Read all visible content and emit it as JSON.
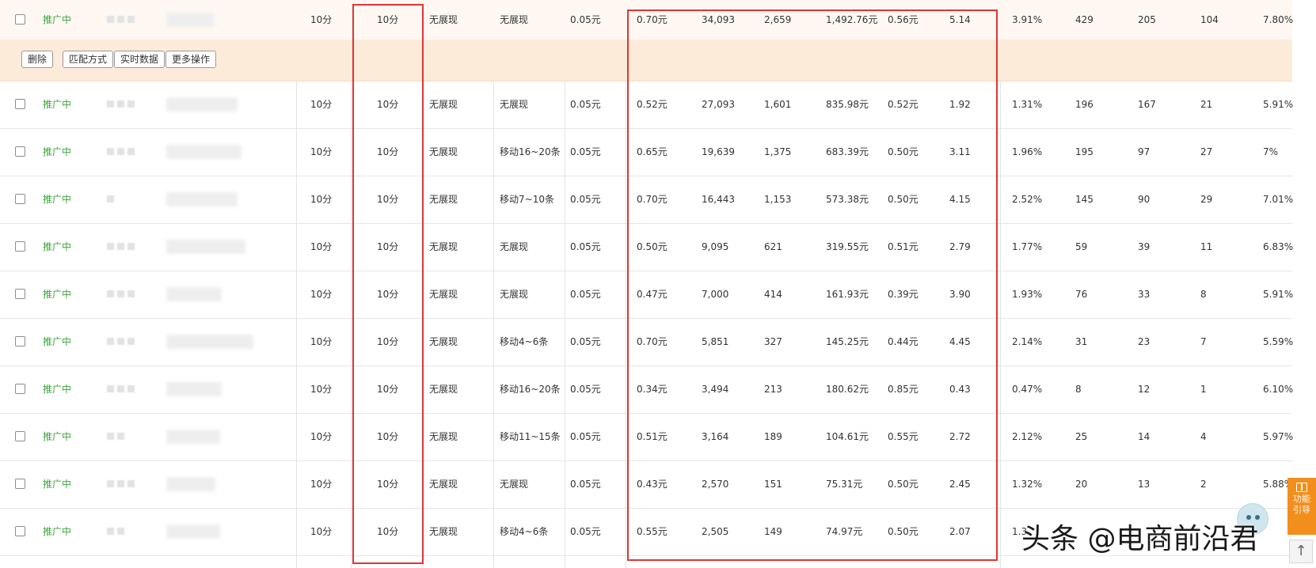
{
  "status_label": "推广中",
  "actions": [
    "删除",
    "匹配方式",
    "实时数据",
    "更多操作"
  ],
  "rows": [
    {
      "a": "10分",
      "b": "10分",
      "c": "无展现",
      "d": "无展现",
      "e": "0.05元",
      "f": "0.70元",
      "g": "34,093",
      "h": "2,659",
      "i": "1,492.76元",
      "j": "0.56元",
      "k": "5.14",
      "l": "3.91%",
      "m": "429",
      "n": "205",
      "o": "104",
      "p": "7.80%"
    },
    {
      "a": "10分",
      "b": "10分",
      "c": "无展现",
      "d": "无展现",
      "e": "0.05元",
      "f": "0.52元",
      "g": "27,093",
      "h": "1,601",
      "i": "835.98元",
      "j": "0.52元",
      "k": "1.92",
      "l": "1.31%",
      "m": "196",
      "n": "167",
      "o": "21",
      "p": "5.91%"
    },
    {
      "a": "10分",
      "b": "10分",
      "c": "无展现",
      "d": "移动16~20条",
      "e": "0.05元",
      "f": "0.65元",
      "g": "19,639",
      "h": "1,375",
      "i": "683.39元",
      "j": "0.50元",
      "k": "3.11",
      "l": "1.96%",
      "m": "195",
      "n": "97",
      "o": "27",
      "p": "7%"
    },
    {
      "a": "10分",
      "b": "10分",
      "c": "无展现",
      "d": "移动7~10条",
      "e": "0.05元",
      "f": "0.70元",
      "g": "16,443",
      "h": "1,153",
      "i": "573.38元",
      "j": "0.50元",
      "k": "4.15",
      "l": "2.52%",
      "m": "145",
      "n": "90",
      "o": "29",
      "p": "7.01%"
    },
    {
      "a": "10分",
      "b": "10分",
      "c": "无展现",
      "d": "无展现",
      "e": "0.05元",
      "f": "0.50元",
      "g": "9,095",
      "h": "621",
      "i": "319.55元",
      "j": "0.51元",
      "k": "2.79",
      "l": "1.77%",
      "m": "59",
      "n": "39",
      "o": "11",
      "p": "6.83%"
    },
    {
      "a": "10分",
      "b": "10分",
      "c": "无展现",
      "d": "无展现",
      "e": "0.05元",
      "f": "0.47元",
      "g": "7,000",
      "h": "414",
      "i": "161.93元",
      "j": "0.39元",
      "k": "3.90",
      "l": "1.93%",
      "m": "76",
      "n": "33",
      "o": "8",
      "p": "5.91%"
    },
    {
      "a": "10分",
      "b": "10分",
      "c": "无展现",
      "d": "移动4~6条",
      "e": "0.05元",
      "f": "0.70元",
      "g": "5,851",
      "h": "327",
      "i": "145.25元",
      "j": "0.44元",
      "k": "4.45",
      "l": "2.14%",
      "m": "31",
      "n": "23",
      "o": "7",
      "p": "5.59%"
    },
    {
      "a": "10分",
      "b": "10分",
      "c": "无展现",
      "d": "移动16~20条",
      "e": "0.05元",
      "f": "0.34元",
      "g": "3,494",
      "h": "213",
      "i": "180.62元",
      "j": "0.85元",
      "k": "0.43",
      "l": "0.47%",
      "m": "8",
      "n": "12",
      "o": "1",
      "p": "6.10%"
    },
    {
      "a": "10分",
      "b": "10分",
      "c": "无展现",
      "d": "移动11~15条",
      "e": "0.05元",
      "f": "0.51元",
      "g": "3,164",
      "h": "189",
      "i": "104.61元",
      "j": "0.55元",
      "k": "2.72",
      "l": "2.12%",
      "m": "25",
      "n": "14",
      "o": "4",
      "p": "5.97%"
    },
    {
      "a": "10分",
      "b": "10分",
      "c": "无展现",
      "d": "无展现",
      "e": "0.05元",
      "f": "0.43元",
      "g": "2,570",
      "h": "151",
      "i": "75.31元",
      "j": "0.50元",
      "k": "2.45",
      "l": "1.32%",
      "m": "20",
      "n": "13",
      "o": "2",
      "p": "5.88%"
    },
    {
      "a": "10分",
      "b": "10分",
      "c": "无展现",
      "d": "移动4~6条",
      "e": "0.05元",
      "f": "0.55元",
      "g": "2,505",
      "h": "149",
      "i": "74.97元",
      "j": "0.50元",
      "k": "2.07",
      "l": "1.3",
      "m": "",
      "n": "",
      "o": "",
      "p": ""
    }
  ],
  "side_panel": {
    "line1": "功能",
    "line2": "引导",
    "icon": "book-icon"
  },
  "scroll_top_icon": "arrow-up-icon",
  "watermark": "头条 @电商前沿君",
  "colors": {
    "status_green": "#3aa63a",
    "highlight_red": "#e03535",
    "action_bar": "#fdebd9",
    "side_orange": "#f28e1c"
  }
}
